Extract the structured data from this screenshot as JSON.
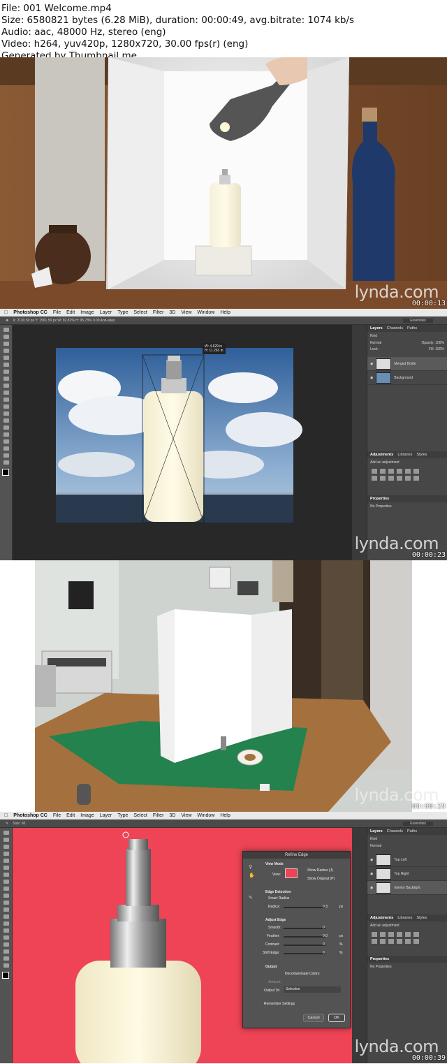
{
  "header": {
    "line1": "File: 001 Welcome.mp4",
    "line2": "Size: 6580821 bytes (6.28 MiB), duration: 00:00:49, avg.bitrate: 1074 kb/s",
    "line3": "Audio: aac, 48000 Hz, stereo (eng)",
    "line4": "Video: h264, yuv420p, 1280x720, 30.00 fps(r) (eng)",
    "line5": "Generated by Thumbnail me"
  },
  "watermark": "lynda.com",
  "frames": [
    {
      "timestamp": "00:00:13"
    },
    {
      "timestamp": "00:00:23"
    },
    {
      "timestamp": "00:00:29"
    },
    {
      "timestamp": "00:00:39"
    }
  ],
  "photoshop": {
    "menu": [
      "Photoshop CC",
      "File",
      "Edit",
      "Image",
      "Layer",
      "Type",
      "Select",
      "Filter",
      "3D",
      "View",
      "Window",
      "Help"
    ],
    "options_frame2": "X: 2130.50 px   Y: 1561.50 px   W: 92.82%   H: 95.78%   0.00   Anti-alias",
    "options_frame4": "Size: 60",
    "transform_tip": [
      "W:  4.629 in",
      "H: 11.263 in"
    ],
    "panel_tabs": [
      "Layers",
      "Channels",
      "Paths"
    ],
    "kind": "Kind",
    "blend": "Normal",
    "opacity": "Opacity: 100%",
    "fill": "Fill: 100%",
    "lock": "Lock:",
    "layers_frame2": [
      "Merged Bottle",
      "Background"
    ],
    "layers_frame4": [
      "Top Left",
      "Top Right",
      "Interior Backlight"
    ],
    "adjust_tabs": [
      "Adjustments",
      "Libraries",
      "Styles"
    ],
    "add_adjustment": "Add an adjustment",
    "properties": "Properties",
    "no_properties": "No Properties",
    "essentials": "Essentials",
    "refine_edge": {
      "title": "Refine Edge",
      "view_mode": "View Mode",
      "view": "View:",
      "show_radius": "Show Radius (J)",
      "show_original": "Show Original (P)",
      "edge_detection": "Edge Detection",
      "smart_radius": "Smart Radius",
      "radius": "Radius:",
      "radius_value": "0.3",
      "px": "px",
      "adjust_edge": "Adjust Edge",
      "smooth": "Smooth:",
      "smooth_value": "0",
      "feather": "Feather:",
      "feather_value": "0.0",
      "contrast": "Contrast:",
      "contrast_value": "0",
      "shift_edge": "Shift Edge:",
      "shift_value": "0",
      "percent": "%",
      "output": "Output",
      "decontaminate": "Decontaminate Colors",
      "amount": "Amount:",
      "output_to": "Output To:",
      "output_value": "Selection",
      "remember": "Remember Settings",
      "cancel": "Cancel",
      "ok": "OK"
    }
  },
  "colors": {
    "accent_pink": "#ee4455",
    "ps_dark": "#282828"
  }
}
